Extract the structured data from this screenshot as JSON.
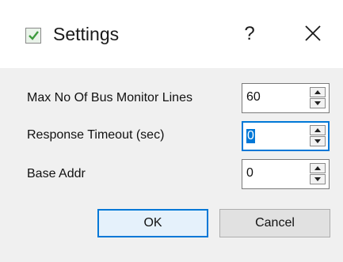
{
  "window": {
    "title": "Settings",
    "help_label": "?",
    "close_label": "×"
  },
  "fields": [
    {
      "label": "Max No Of Bus Monitor Lines",
      "value": "60"
    },
    {
      "label": "Response Timeout (sec)",
      "value": "0"
    },
    {
      "label": "Base Addr",
      "value": "0"
    }
  ],
  "buttons": {
    "ok_label": "OK",
    "cancel_label": "Cancel"
  },
  "colors": {
    "accent": "#0078d7",
    "client_background": "#f0f0f0",
    "titlebar_background": "#ffffff"
  },
  "icons": {
    "app": "checkbox-icon",
    "spin_up": "chevron-up-icon",
    "spin_down": "chevron-down-icon"
  }
}
